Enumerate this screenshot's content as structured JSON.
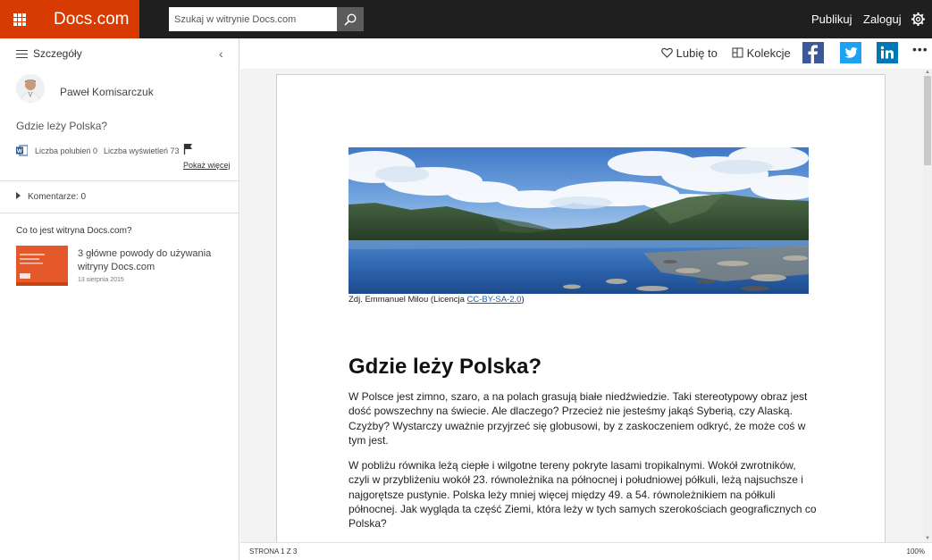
{
  "app": {
    "brand": "Docs.com"
  },
  "search": {
    "placeholder": "Szukaj w witrynie Docs.com"
  },
  "topnav": {
    "publish": "Publikuj",
    "login": "Zaloguj"
  },
  "sidebar": {
    "title": "Szczegóły",
    "author": "Paweł Komisarczuk",
    "doc_title": "Gdzie leży Polska?",
    "likes": "Liczba polubień 0",
    "views": "Liczba wyświetleń 73",
    "show_more": "Pokaż więcej",
    "comments": "Komentarze: 0",
    "what_is": "Co to jest witryna Docs.com?",
    "promo": {
      "title": "3 główne powody do używania witryny Docs.com",
      "date": "13 sierpnia 2015"
    }
  },
  "toolbar": {
    "like": "Lubię to",
    "collections": "Kolekcje",
    "more": "•••"
  },
  "document": {
    "caption_prefix": "Zdj. Emmanuel Milou (Licencja ",
    "caption_link": "CC-BY-SA-2.0",
    "caption_suffix": ")",
    "heading": "Gdzie leży Polska?",
    "paragraph1": "W Polsce jest zimno, szaro, a na polach grasują białe niedźwiedzie. Taki stereotypowy obraz jest dość powszechny na świecie. Ale dlaczego? Przecież nie jesteśmy jakąś Syberią, czy Alaską. Czyżby? Wystarczy uważnie przyjrzeć się globusowi, by z zaskoczeniem odkryć, że może coś w tym jest.",
    "paragraph2": "W pobliżu równika leżą ciepłe i wilgotne tereny pokryte lasami tropikalnymi. Wokół zwrotników, czyli w przybliżeniu wokół 23. równoleżnika na północnej i południowej półkuli, leżą najsuchsze i najgorętsze pustynie. Polska leży mniej więcej między 49. a 54. równoleżnikiem na półkuli północnej. Jak wygląda ta część Ziemi, która leży w tych samych szerokościach geograficznych co Polska?"
  },
  "status": {
    "page": "STRONA 1 Z 3",
    "zoom": "100%"
  },
  "colors": {
    "brand": "#d83b01",
    "topbar": "#1f1f1f",
    "facebook": "#3b5998",
    "twitter": "#1da1f2",
    "linkedin": "#0077b5"
  }
}
